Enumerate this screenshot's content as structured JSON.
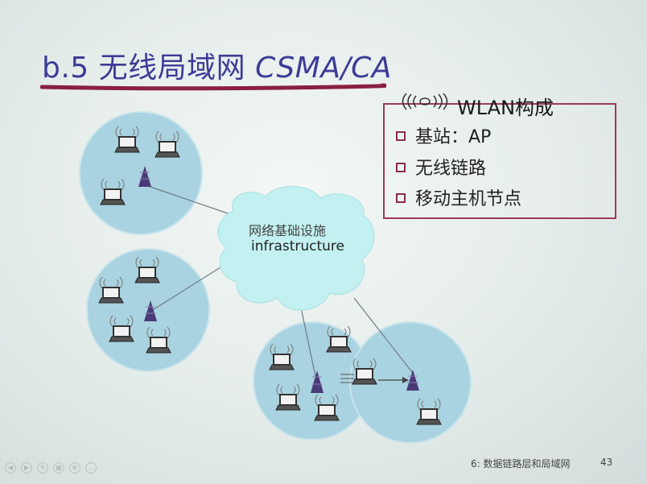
{
  "slide": {
    "title_prefix": "b.5 ",
    "title_cn": "无线局域网 ",
    "title_latin": "CSMA/CA"
  },
  "wlan": {
    "heading": "WLAN构成",
    "items": [
      {
        "label": "基站：AP"
      },
      {
        "label": "无线链路"
      },
      {
        "label": "移动主机节点"
      }
    ]
  },
  "diagram": {
    "cloud_label_cn": "网络基础设施",
    "cloud_label_en": "infrastructure"
  },
  "footer": {
    "chapter": "6: 数据链路层和局域网",
    "page": "43"
  },
  "colors": {
    "title": "#3c3c96",
    "underline": "#8a1f3f",
    "box_border": "#9b3b55",
    "cell": "#a9d3e0",
    "cloud": "#c3f0f0",
    "antenna": "#4a3a78"
  }
}
